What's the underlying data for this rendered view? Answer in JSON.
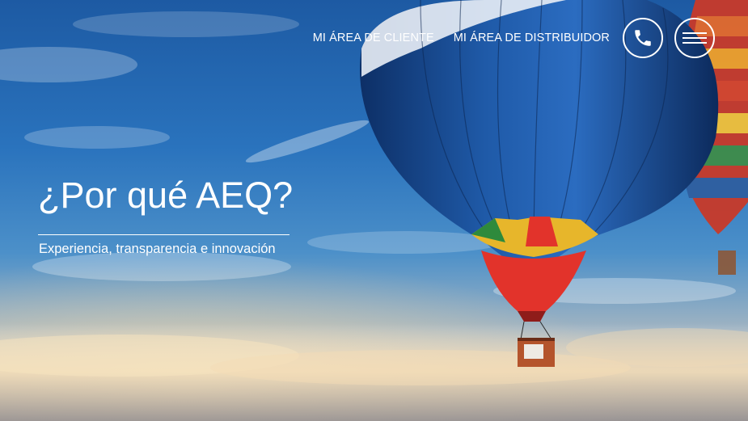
{
  "nav": {
    "client_area": "MI ÁREA DE CLIENTE",
    "distributor_area": "MI ÁREA DE DISTRIBUIDOR",
    "phone_icon": "phone-icon",
    "menu_icon": "hamburger-menu-icon"
  },
  "hero": {
    "headline": "¿Por qué AEQ?",
    "subtitle": "Experiencia, transparencia e innovación"
  },
  "colors": {
    "sky_top": "#1f5fa8",
    "balloon_blue": "#1e4f96",
    "balloon_red": "#e2332b",
    "text": "#ffffff"
  }
}
